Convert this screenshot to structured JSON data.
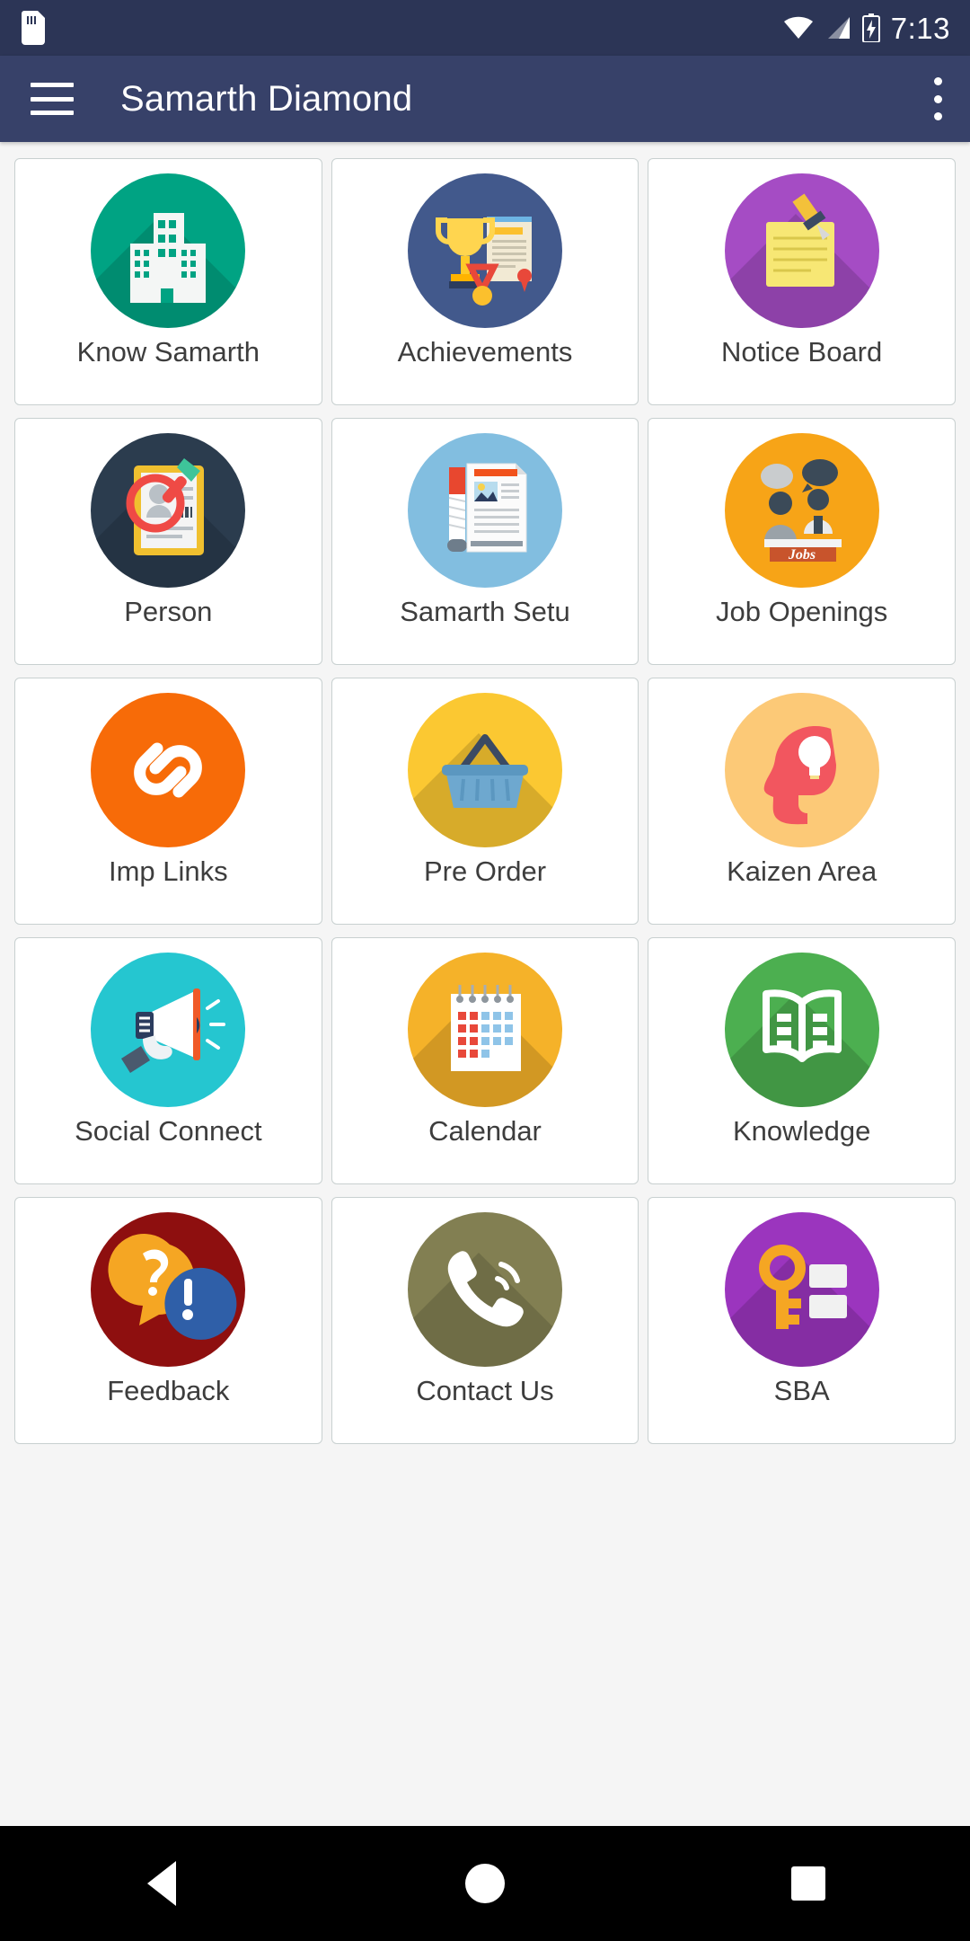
{
  "statusbar": {
    "time": "7:13",
    "icons": [
      "sd-card-icon",
      "wifi-icon",
      "cellular-signal-icon",
      "battery-charging-icon"
    ]
  },
  "appbar": {
    "title": "Samarth Diamond",
    "menu_icon": "hamburger-menu-icon",
    "overflow_icon": "overflow-menu-icon"
  },
  "grid": {
    "items": [
      {
        "label": "Know Samarth",
        "icon": "buildings-icon",
        "color": "#00a383"
      },
      {
        "label": "Achievements",
        "icon": "trophy-certificate-icon",
        "color": "#42598c"
      },
      {
        "label": "Notice Board",
        "icon": "notepad-pin-icon",
        "color": "#a54cc4"
      },
      {
        "label": "Person",
        "icon": "id-card-search-icon",
        "color": "#2b3c4e"
      },
      {
        "label": "Samarth Setu",
        "icon": "newspaper-icon",
        "color": "#82bee0"
      },
      {
        "label": "Job Openings",
        "icon": "job-interview-icon",
        "color": "#f7a417"
      },
      {
        "label": "Imp Links",
        "icon": "chain-link-icon",
        "color": "#f76b08"
      },
      {
        "label": "Pre Order",
        "icon": "shopping-basket-icon",
        "color": "#fbc832"
      },
      {
        "label": "Kaizen Area",
        "icon": "head-lightbulb-icon",
        "color": "#fcc977"
      },
      {
        "label": "Social Connect",
        "icon": "megaphone-icon",
        "color": "#25c6d0"
      },
      {
        "label": "Calendar",
        "icon": "calendar-icon",
        "color": "#f5b229"
      },
      {
        "label": "Knowledge",
        "icon": "open-book-icon",
        "color": "#4caf50"
      },
      {
        "label": "Feedback",
        "icon": "speech-bubbles-icon",
        "color": "#8e0f0f"
      },
      {
        "label": "Contact Us",
        "icon": "phone-ringing-icon",
        "color": "#827f52"
      },
      {
        "label": "SBA",
        "icon": "key-blocks-icon",
        "color": "#9b35be"
      }
    ]
  },
  "navbar": {
    "back": "back-button",
    "home": "home-button",
    "recents": "recents-button"
  }
}
